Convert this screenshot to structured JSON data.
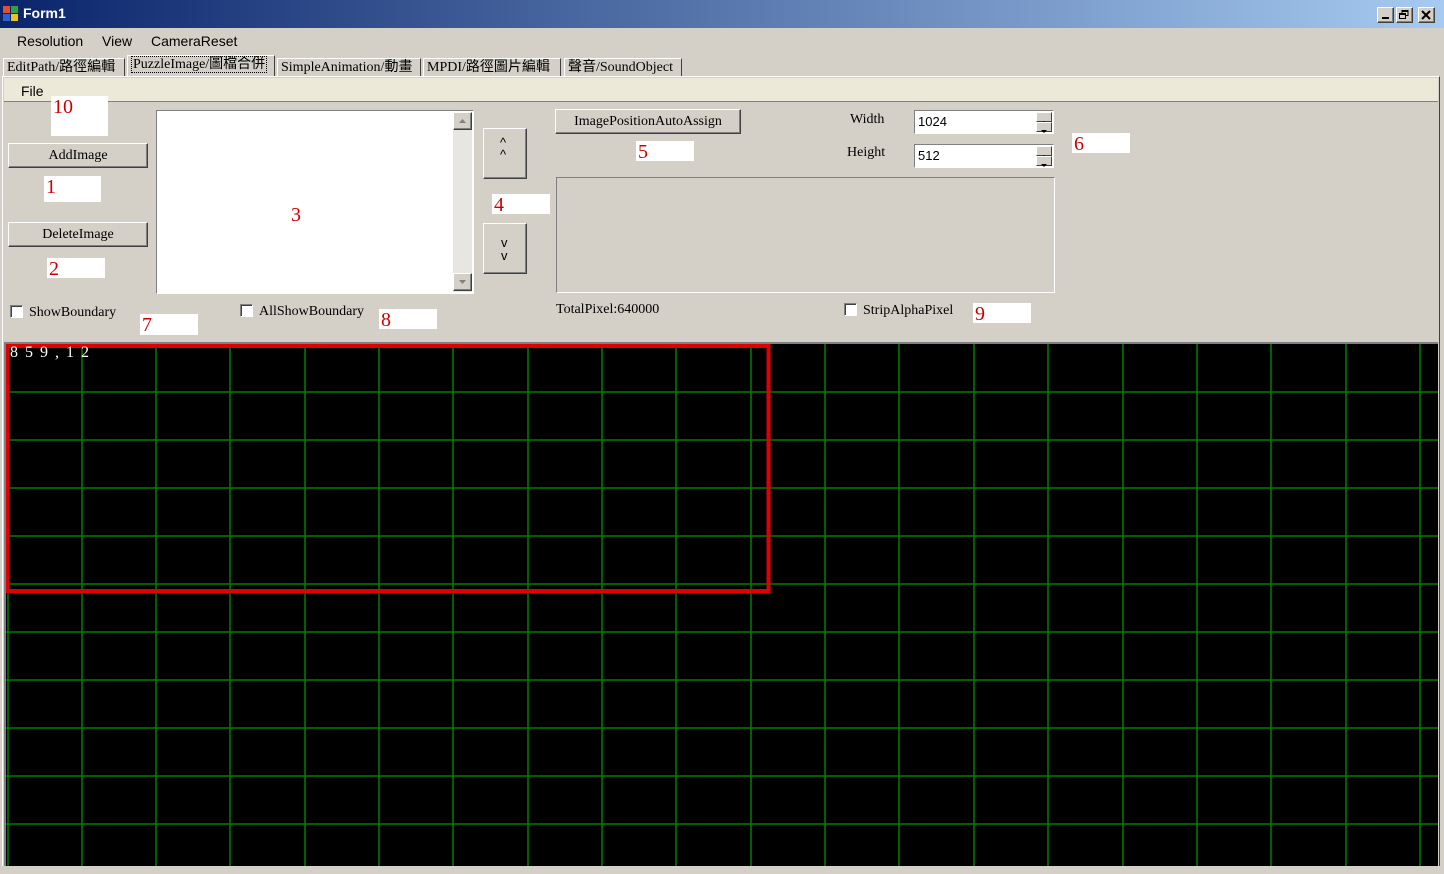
{
  "window": {
    "title": "Form1",
    "controls": {
      "minimize": "minimize-icon",
      "restore": "restore-icon",
      "close": "close-icon"
    }
  },
  "menu": {
    "items": [
      "Resolution",
      "View",
      "CameraReset"
    ]
  },
  "tabs": [
    {
      "label": "EditPath/路徑編輯",
      "active": false
    },
    {
      "label": "PuzzleImage/圖檔合併",
      "active": true
    },
    {
      "label": "SimpleAnimation/動畫",
      "active": false
    },
    {
      "label": "MPDI/路徑圖片編輯",
      "active": false
    },
    {
      "label": "聲音/SoundObject",
      "active": false
    }
  ],
  "file_menu": {
    "label": "File"
  },
  "controls": {
    "add_image": "AddImage",
    "delete_image": "DeleteImage",
    "move_up": "^\n^",
    "move_down": "v\nv",
    "auto_assign": "ImagePositionAutoAssign",
    "width_label": "Width",
    "height_label": "Height",
    "width_value": "1024",
    "height_value": "512",
    "total_pixel": "TotalPixel:640000",
    "show_boundary": "ShowBoundary",
    "all_show_boundary": "AllShowBoundary",
    "strip_alpha_pixel": "StripAlphaPixel"
  },
  "annotations": {
    "a1": "1",
    "a2": "2",
    "a3": "3",
    "a4": "4",
    "a5": "5",
    "a6": "6",
    "a7": "7",
    "a8": "8",
    "a9": "9",
    "a10": "10"
  },
  "canvas": {
    "coordinate_readout": "859,12",
    "grid_color": "#008000",
    "boundary_color": "#e00000",
    "background": "#000000"
  },
  "colors": {
    "titlebar_start": "#0a246a",
    "titlebar_end": "#a6caf0",
    "face": "#d4d0c8"
  }
}
